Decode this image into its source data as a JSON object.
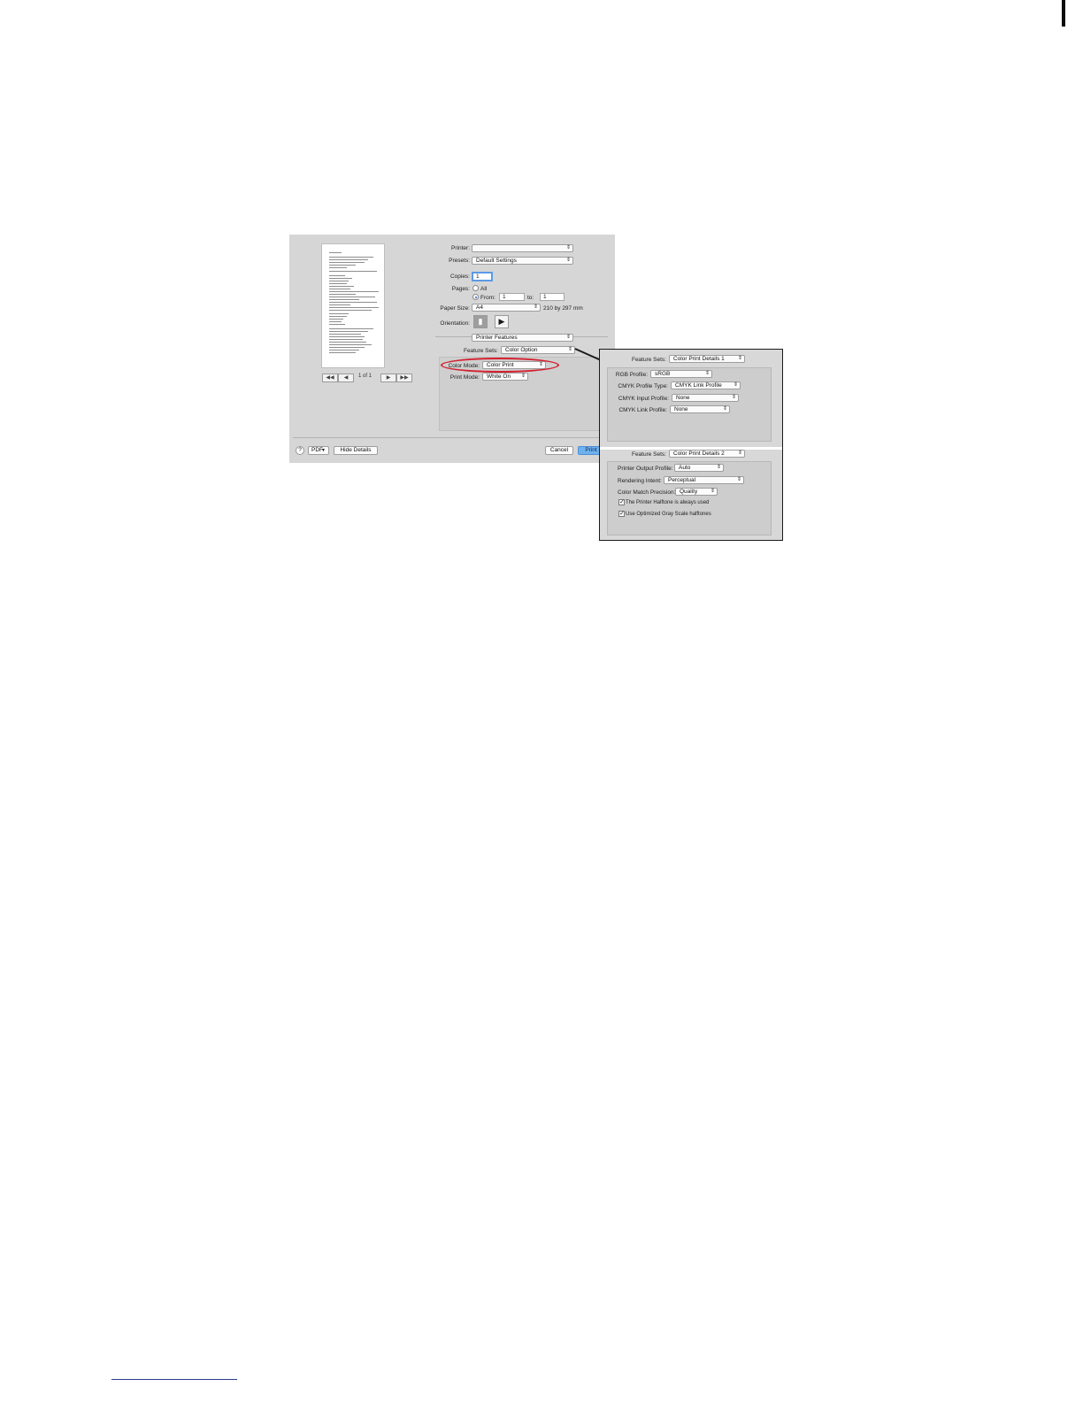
{
  "dialog": {
    "printer": {
      "label": "Printer:",
      "value": ""
    },
    "presets": {
      "label": "Presets:",
      "value": "Default Settings"
    },
    "copies": {
      "label": "Copies:",
      "value": "1"
    },
    "pages": {
      "label": "Pages:",
      "all_label": "All",
      "from_label": "From:",
      "from_value": "1",
      "to_label": "to:",
      "to_value": "1",
      "selected": "From"
    },
    "paper_size": {
      "label": "Paper Size:",
      "value": "A4",
      "dimensions": "210 by 297 mm"
    },
    "orientation": {
      "label": "Orientation:",
      "selected": "portrait"
    },
    "section_popup": "Printer Features",
    "feature_sets": {
      "label": "Feature Sets:",
      "value": "Color Option"
    },
    "color_mode": {
      "label": "Color Mode:",
      "value": "Color Print"
    },
    "print_mode": {
      "label": "Print Mode:",
      "value": "White On"
    },
    "preview": {
      "page_count": "1 of 1"
    },
    "footer": {
      "help_label": "?",
      "pdf_label": "PDF",
      "hide_details_label": "Hide Details",
      "cancel_label": "Cancel",
      "print_label": "Print"
    }
  },
  "callout": {
    "panel1": {
      "feature_sets_label": "Feature Sets:",
      "feature_sets_value": "Color Print Details 1",
      "rgb_profile": {
        "label": "RGB Profile:",
        "value": "sRGB"
      },
      "cmyk_profile_type": {
        "label": "CMYK Profile Type:",
        "value": "CMYK Link Profile"
      },
      "cmyk_input_profile": {
        "label": "CMYK Input Profile:",
        "value": "None"
      },
      "cmyk_link_profile": {
        "label": "CMYK Link Profile:",
        "value": "None"
      }
    },
    "panel2": {
      "feature_sets_label": "Feature Sets:",
      "feature_sets_value": "Color Print Details 2",
      "printer_output_profile": {
        "label": "Printer Output Profile:",
        "value": "Auto"
      },
      "rendering_intent": {
        "label": "Rendering Intent:",
        "value": "Perceptual"
      },
      "color_match_precision": {
        "label": "Color Match Precision:",
        "value": "Quality"
      },
      "halftone_always_used": {
        "label": "The Printer Halftone is always used",
        "checked": true
      },
      "optimized_gray_scale": {
        "label": "Use Optimized Gray Scale halftones",
        "checked": true
      }
    }
  },
  "colors": {
    "highlight": "#d4202f",
    "default_button": "#6fb1ee"
  },
  "icons": {
    "updown_arrows": "popup-arrows-icon",
    "first_page": "first-page-icon",
    "prev_page": "previous-page-icon",
    "next_page": "next-page-icon",
    "last_page": "last-page-icon"
  }
}
